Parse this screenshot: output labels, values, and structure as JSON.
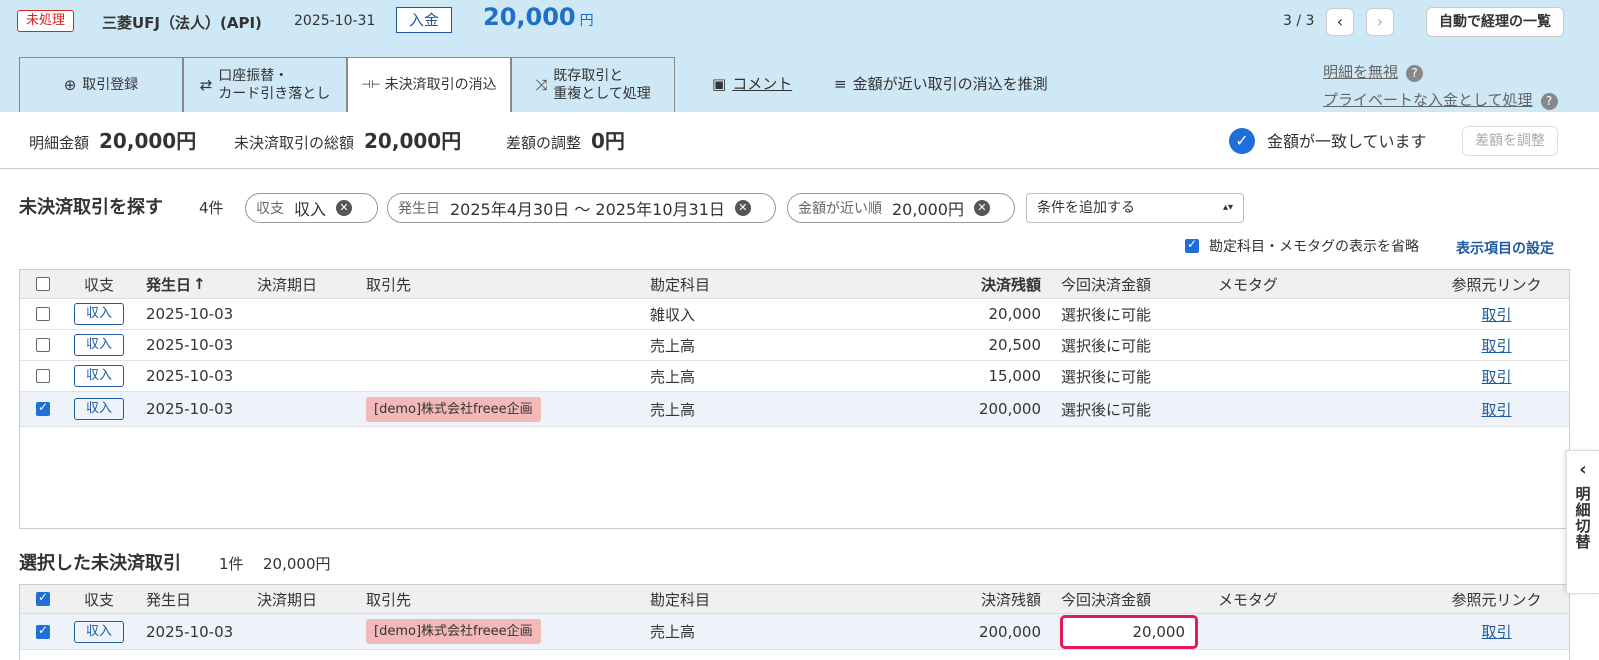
{
  "header": {
    "status_badge": "未処理",
    "bank_name": "三菱UFJ（法人）(API)",
    "date": "2025-10-31",
    "type_badge": "入金",
    "amount": "20,000",
    "currency": "円",
    "pager": "3 / 3",
    "prev_icon": "‹",
    "next_icon": "›",
    "auto_button": "自動で経理の一覧"
  },
  "tabs": [
    {
      "icon": "⊕",
      "label": "取引登録"
    },
    {
      "icon": "⇄",
      "label": "口座振替・\nカード引き落とし"
    },
    {
      "icon": "⊣⊢",
      "label": "未決済取引の消込"
    },
    {
      "icon": "⤨",
      "label": "既存取引と\n重複として処理"
    }
  ],
  "header_links": {
    "comment": "コメント",
    "guess": "金額が近い取引の消込を推測",
    "ignore": "明細を無視",
    "private": "プライベートな入金として処理",
    "help": "?"
  },
  "summary": {
    "statement_label": "明細金額",
    "statement_value": "20,000円",
    "total_label": "未決済取引の総額",
    "total_value": "20,000円",
    "diff_label": "差額の調整",
    "diff_value": "0円",
    "match_text": "金額が一致しています",
    "adjust_button": "差額を調整"
  },
  "search": {
    "title": "未決済取引を探す",
    "count": "4件",
    "chips": [
      {
        "key": "収支",
        "value": "収入"
      },
      {
        "key": "発生日",
        "value": "2025年4月30日 〜 2025年10月31日"
      },
      {
        "key": "金額が近い順",
        "value": "20,000円"
      }
    ],
    "add_condition": "条件を追加する",
    "omit_label": "勘定科目・メモタグの表示を省略",
    "display_settings": "表示項目の設定"
  },
  "columns": {
    "type": "収支",
    "date": "発生日",
    "sort_arrow": "↑",
    "due": "決済期日",
    "partner": "取引先",
    "account": "勘定科目",
    "balance": "決済残額",
    "settle": "今回決済金額",
    "memo": "メモタグ",
    "ref": "参照元リンク"
  },
  "rows": [
    {
      "type": "収入",
      "date": "2025-10-03",
      "partner": "",
      "account": "雑収入",
      "balance": "20,000",
      "settle": "選択後に可能",
      "ref": "取引"
    },
    {
      "type": "収入",
      "date": "2025-10-03",
      "partner": "",
      "account": "売上高",
      "balance": "20,500",
      "settle": "選択後に可能",
      "ref": "取引"
    },
    {
      "type": "収入",
      "date": "2025-10-03",
      "partner": "",
      "account": "売上高",
      "balance": "15,000",
      "settle": "選択後に可能",
      "ref": "取引"
    },
    {
      "type": "収入",
      "date": "2025-10-03",
      "partner": "[demo]株式会社freee企画",
      "account": "売上高",
      "balance": "200,000",
      "settle": "選択後に可能",
      "ref": "取引"
    }
  ],
  "selected": {
    "title": "選択した未決済取引",
    "count": "1件",
    "total": "20,000円",
    "rows": [
      {
        "type": "収入",
        "date": "2025-10-03",
        "partner": "[demo]株式会社freee企画",
        "account": "売上高",
        "balance": "200,000",
        "settle": "20,000",
        "ref": "取引"
      }
    ]
  },
  "side_tab": {
    "chevron": "‹",
    "label": "明細切替"
  }
}
